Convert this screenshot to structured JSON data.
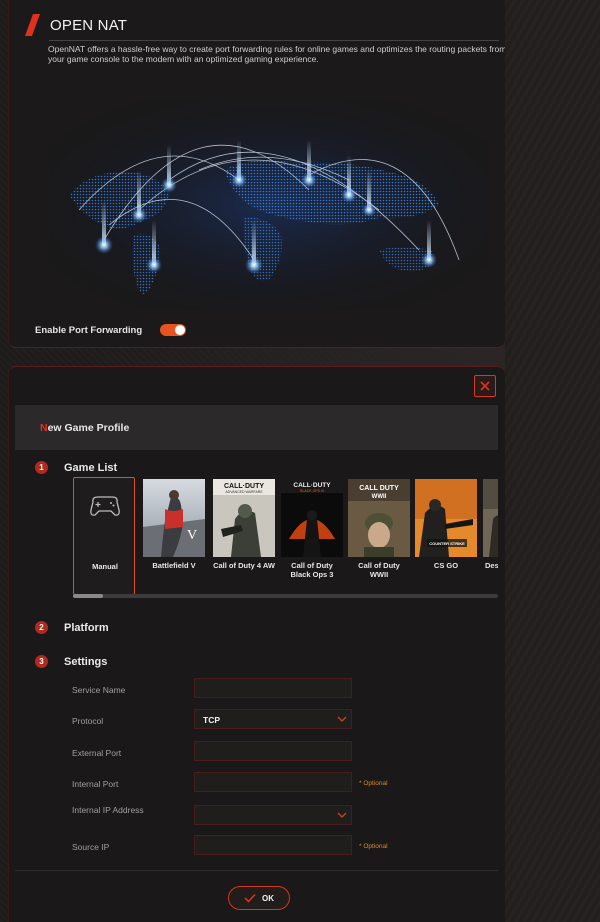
{
  "nat": {
    "title": "OPEN NAT",
    "description": "OpenNAT offers a hassle-free way to create port forwarding rules for online games and optimizes the routing packets from your game console to the modem with an optimized gaming experience.",
    "enable_label": "Enable Port Forwarding",
    "enabled": true
  },
  "modal": {
    "title_first": "N",
    "title_rest": "ew Game Profile",
    "steps": [
      {
        "num": "1",
        "label": "Game List"
      },
      {
        "num": "2",
        "label": "Platform"
      },
      {
        "num": "3",
        "label": "Settings"
      }
    ],
    "games": [
      {
        "name": "Manual",
        "selected": true
      },
      {
        "name": "Battlefield V",
        "selected": false
      },
      {
        "name": "Call of Duty 4 AW",
        "selected": false
      },
      {
        "name": "Call of Duty Black Ops 3",
        "selected": false
      },
      {
        "name": "Call of Duty WWII",
        "selected": false
      },
      {
        "name": "CS GO",
        "selected": false
      },
      {
        "name": "Des",
        "selected": false
      }
    ],
    "cover_titles": {
      "cod": "CALL·DUTY",
      "cod_sub_aw": "ADVANCED WARFARE",
      "cod_sub_bo": "BLACK OPS III",
      "cod_ww2": "CALL DUTY",
      "cod_ww2_sub": "WWII",
      "bf_sub": "V",
      "csgo": "COUNTER STRIKE"
    },
    "fields": {
      "service_name": {
        "label": "Service Name",
        "value": ""
      },
      "protocol": {
        "label": "Protocol",
        "value": "TCP"
      },
      "external_port": {
        "label": "External Port",
        "value": ""
      },
      "internal_port": {
        "label": "Internal Port",
        "value": "",
        "hint": "* Optional"
      },
      "internal_ip": {
        "label": "Internal IP Address",
        "value": ""
      },
      "source_ip": {
        "label": "Source IP",
        "value": "",
        "hint": "* Optional"
      }
    },
    "ok_label": "OK"
  },
  "colors": {
    "accent": "#e0311f",
    "toggle": "#e8541f",
    "optional": "#e08a1f"
  }
}
